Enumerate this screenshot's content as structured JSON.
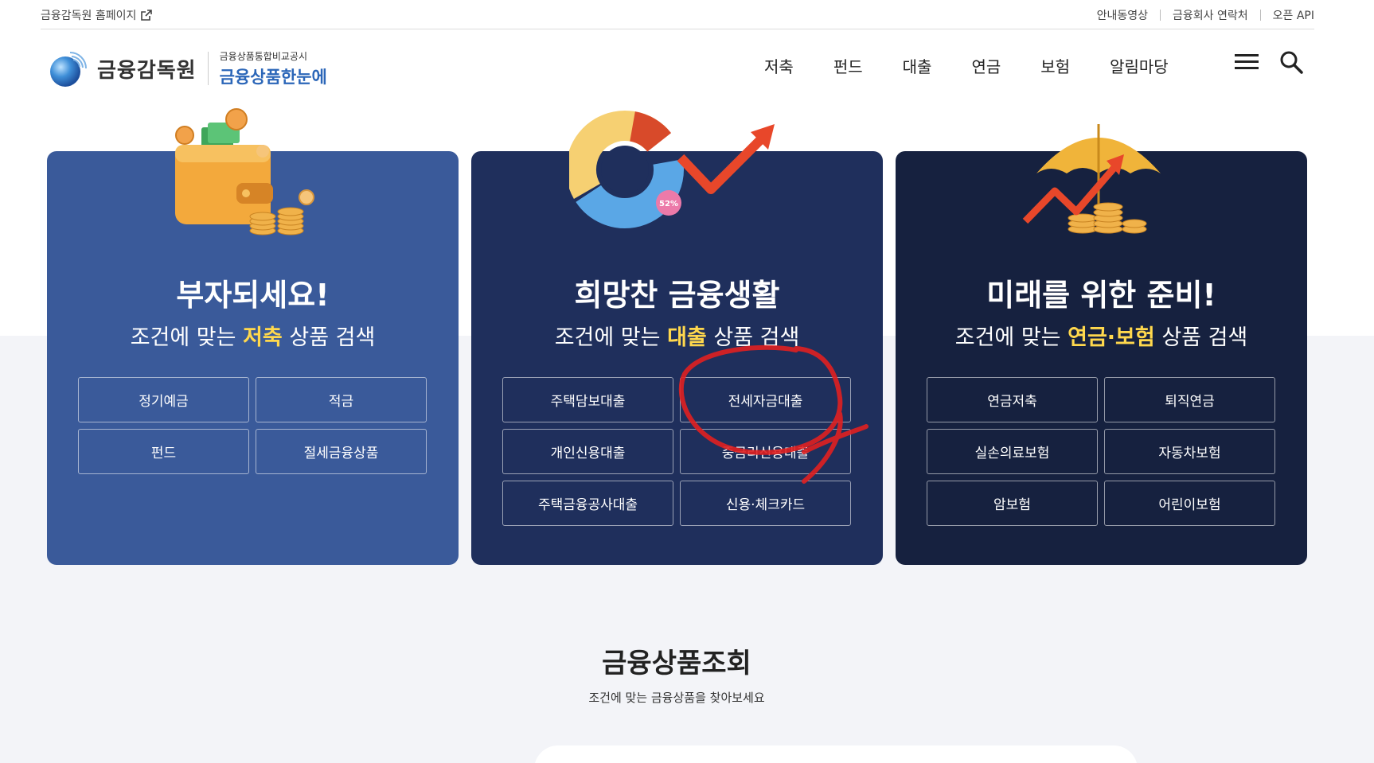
{
  "util": {
    "home_link": "금융감독원 홈페이지",
    "links": [
      "안내동영상",
      "금융회사 연락처",
      "오픈 API"
    ]
  },
  "logo": {
    "main": "금융감독원",
    "sub1": "금융상품통합비교공시",
    "sub2": "금융상품한눈에"
  },
  "gnb": [
    "저축",
    "펀드",
    "대출",
    "연금",
    "보험",
    "알림마당"
  ],
  "cards": [
    {
      "title": "부자되세요!",
      "sub_pre": "조건에 맞는 ",
      "sub_hl": "저축",
      "sub_post": " 상품 검색",
      "buttons": [
        "정기예금",
        "적금",
        "펀드",
        "절세금융상품"
      ]
    },
    {
      "title": "희망찬 금융생활",
      "sub_pre": "조건에 맞는 ",
      "sub_hl": "대출",
      "sub_post": " 상품 검색",
      "buttons": [
        "주택담보대출",
        "전세자금대출",
        "개인신용대출",
        "중금리신용대출",
        "주택금융공사대출",
        "신용·체크카드"
      ]
    },
    {
      "title": "미래를 위한 준비!",
      "sub_pre": "조건에 맞는 ",
      "sub_hl": "연금·보험",
      "sub_post": " 상품 검색",
      "buttons": [
        "연금저축",
        "퇴직연금",
        "실손의료보험",
        "자동차보험",
        "암보험",
        "어린이보험"
      ]
    }
  ],
  "donut_label": "52%",
  "section": {
    "title": "금융상품조회",
    "subtitle": "조건에 맞는 금융상품을 찾아보세요"
  },
  "colors": {
    "card1": "#3a5a9a",
    "card2": "#1f2f5c",
    "card3": "#16213f",
    "highlight": "#ffd84d",
    "annotation": "#e02020"
  }
}
